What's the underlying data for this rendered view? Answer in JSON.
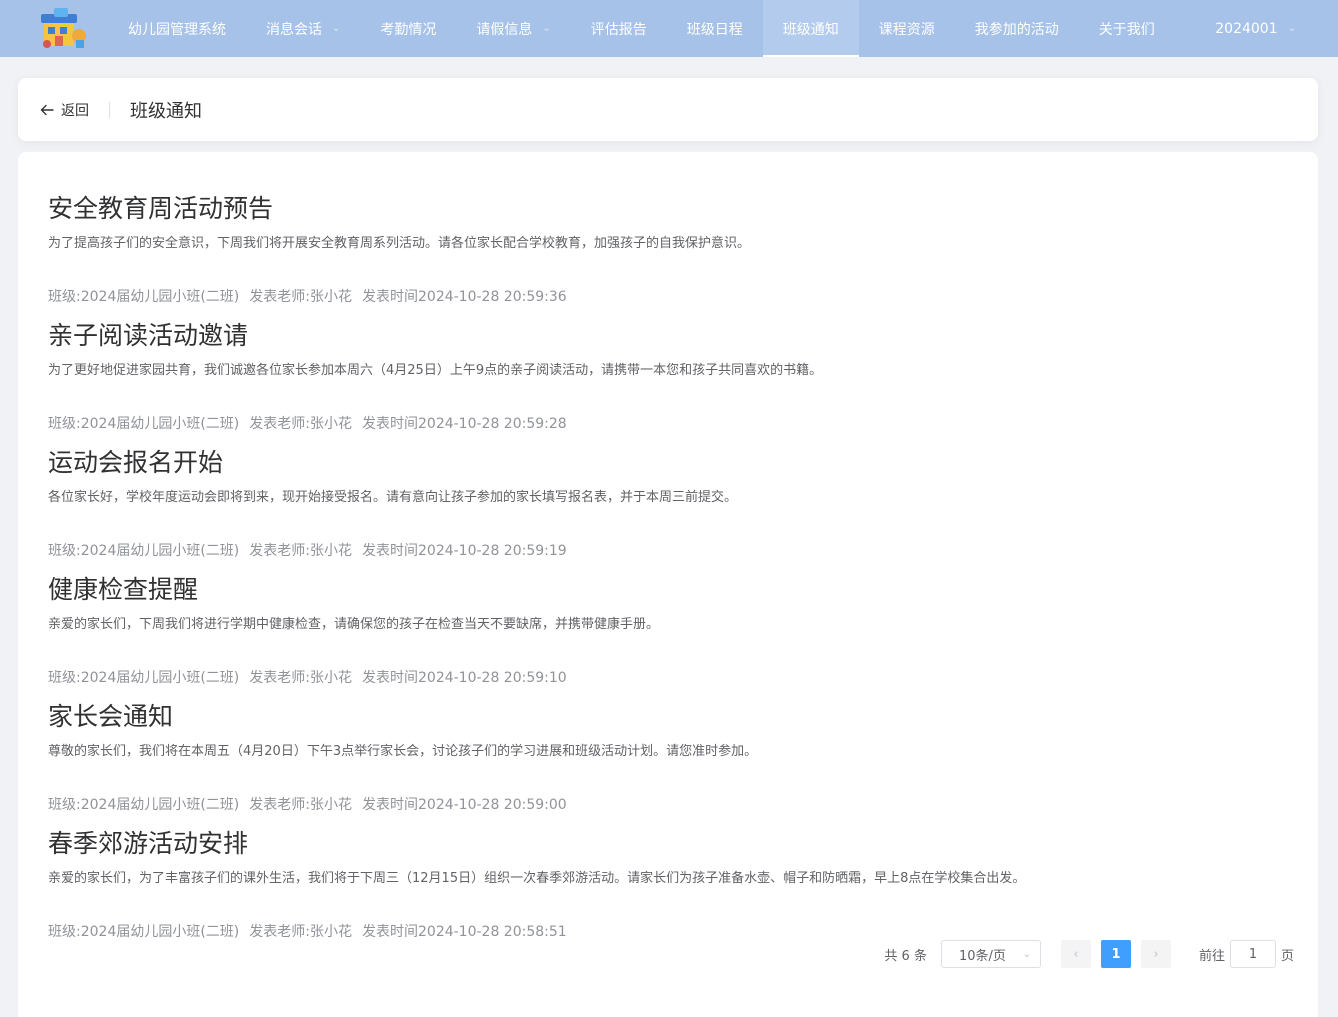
{
  "nav": {
    "items": [
      {
        "label": "幼儿园管理系统",
        "dropdown": false,
        "active": false
      },
      {
        "label": "消息会话",
        "dropdown": true,
        "active": false
      },
      {
        "label": "考勤情况",
        "dropdown": false,
        "active": false
      },
      {
        "label": "请假信息",
        "dropdown": true,
        "active": false
      },
      {
        "label": "评估报告",
        "dropdown": false,
        "active": false
      },
      {
        "label": "班级日程",
        "dropdown": false,
        "active": false
      },
      {
        "label": "班级通知",
        "dropdown": false,
        "active": true
      },
      {
        "label": "课程资源",
        "dropdown": false,
        "active": false
      },
      {
        "label": "我参加的活动",
        "dropdown": false,
        "active": false
      },
      {
        "label": "关于我们",
        "dropdown": false,
        "active": false
      }
    ],
    "user": "2024001",
    "chevron_glyph": "⌄"
  },
  "header": {
    "back_label": "返回",
    "back_icon": "arrow-left-icon",
    "title": "班级通知"
  },
  "notices": [
    {
      "title": "安全教育周活动预告",
      "body": "为了提高孩子们的安全意识，下周我们将开展安全教育周系列活动。请各位家长配合学校教育，加强孩子的自我保护意识。",
      "class": "班级:2024届幼儿园小班(二班)",
      "teacher": "发表老师:张小花",
      "time": "发表时间2024-10-28 20:59:36"
    },
    {
      "title": "亲子阅读活动邀请",
      "body": "为了更好地促进家园共育，我们诚邀各位家长参加本周六（4月25日）上午9点的亲子阅读活动，请携带一本您和孩子共同喜欢的书籍。",
      "class": "班级:2024届幼儿园小班(二班)",
      "teacher": "发表老师:张小花",
      "time": "发表时间2024-10-28 20:59:28"
    },
    {
      "title": "运动会报名开始",
      "body": "各位家长好，学校年度运动会即将到来，现开始接受报名。请有意向让孩子参加的家长填写报名表，并于本周三前提交。",
      "class": "班级:2024届幼儿园小班(二班)",
      "teacher": "发表老师:张小花",
      "time": "发表时间2024-10-28 20:59:19"
    },
    {
      "title": "健康检查提醒",
      "body": "亲爱的家长们，下周我们将进行学期中健康检查，请确保您的孩子在检查当天不要缺席，并携带健康手册。",
      "class": "班级:2024届幼儿园小班(二班)",
      "teacher": "发表老师:张小花",
      "time": "发表时间2024-10-28 20:59:10"
    },
    {
      "title": "家长会通知",
      "body": "尊敬的家长们，我们将在本周五（4月20日）下午3点举行家长会，讨论孩子们的学习进展和班级活动计划。请您准时参加。",
      "class": "班级:2024届幼儿园小班(二班)",
      "teacher": "发表老师:张小花",
      "time": "发表时间2024-10-28 20:59:00"
    },
    {
      "title": "春季郊游活动安排",
      "body": "亲爱的家长们，为了丰富孩子们的课外生活，我们将于下周三（12月15日）组织一次春季郊游活动。请家长们为孩子准备水壶、帽子和防晒霜，早上8点在学校集合出发。",
      "class": "班级:2024届幼儿园小班(二班)",
      "teacher": "发表老师:张小花",
      "time": "发表时间2024-10-28 20:58:51"
    }
  ],
  "pagination": {
    "total": "共 6 条",
    "page_size": "10条/页",
    "current_page": "1",
    "goto_prefix": "前往",
    "goto_value": "1",
    "goto_suffix": "页",
    "prev_glyph": "‹",
    "next_glyph": "›"
  },
  "colors": {
    "nav_bg": "#a6c2e8",
    "primary": "#409eff"
  }
}
